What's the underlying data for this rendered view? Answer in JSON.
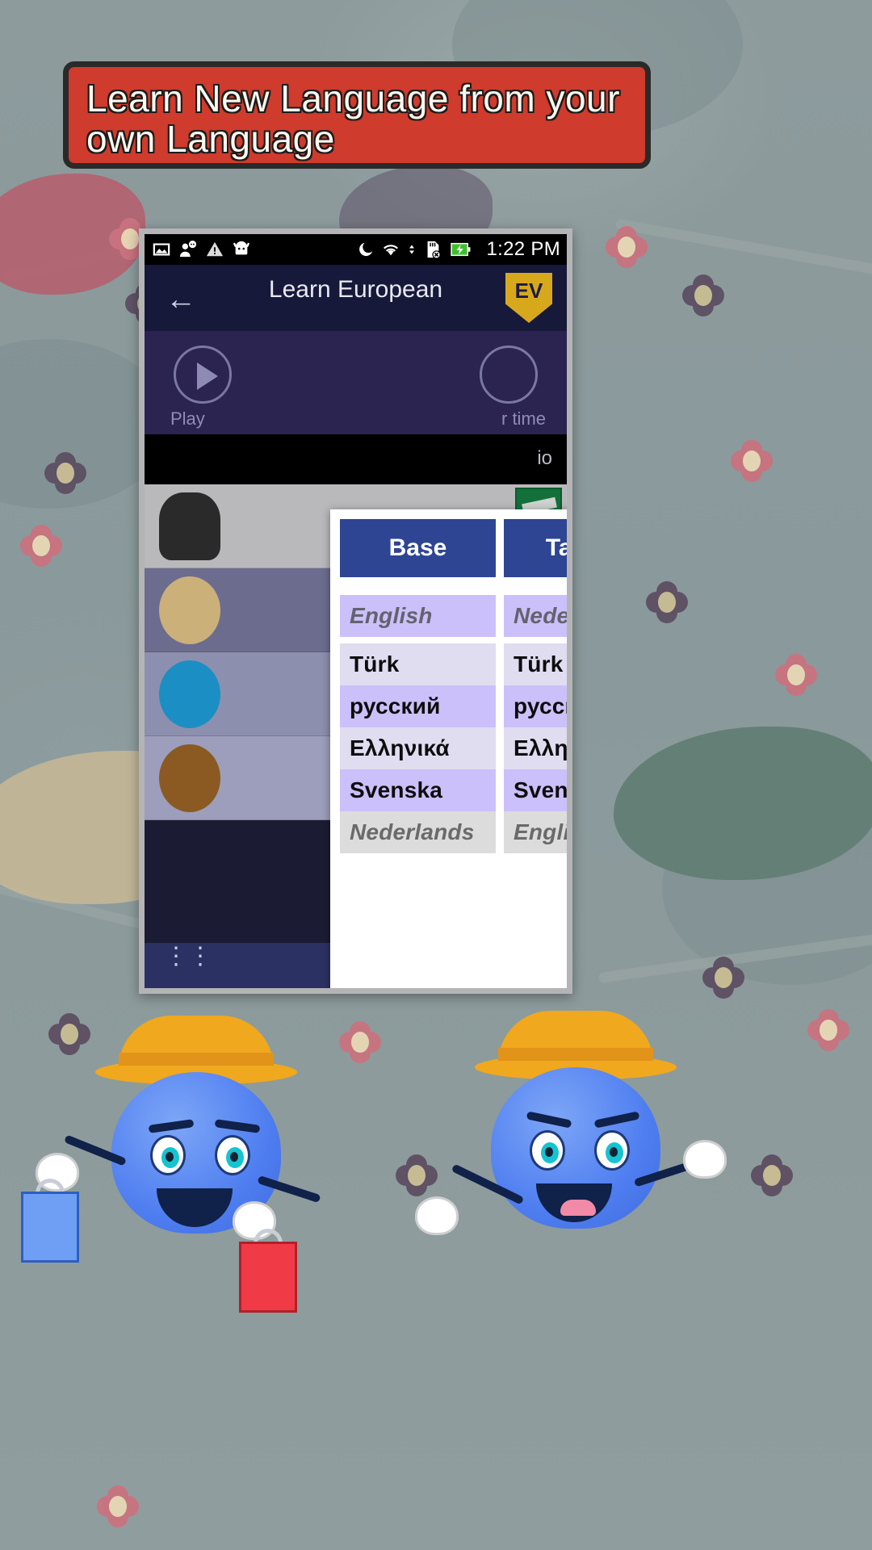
{
  "banner": {
    "line1": "Learn New Language from your",
    "line2": "own Language"
  },
  "statusbar": {
    "time": "1:22 PM",
    "icons": [
      "image-icon",
      "person-speech-icon",
      "warning-triangle-icon",
      "android-robot-icon",
      "do-not-disturb-moon-icon",
      "wifi-icon",
      "sd-card-removed-icon",
      "battery-charging-icon"
    ]
  },
  "background_app": {
    "title": "Learn European",
    "back_label": "←",
    "badge_label": "EV",
    "play_label_left": "Play",
    "play_label_right": "r time",
    "band_label": "io"
  },
  "dialog": {
    "tabs": [
      {
        "label": "Base",
        "name": "base"
      },
      {
        "label": "Target",
        "name": "target"
      }
    ],
    "base_column": {
      "current": "English",
      "options": [
        "Türk",
        "русский",
        "Ελληνικά",
        "Svenska"
      ],
      "disabled": "Nederlands"
    },
    "target_column": {
      "current": "Nederlands",
      "options": [
        "Türk",
        "русский",
        "Ελληνικά",
        "Svenska"
      ],
      "disabled": "English"
    }
  },
  "colors": {
    "banner_red": "#cf3b2c",
    "tab_blue": "#2e4594",
    "row_light": "#e0ddf1",
    "row_lavender": "#ccc0fa",
    "row_disabled": "#dcdcdc",
    "wallpaper": "#8b9a9c",
    "battery_green": "#3fbf2e"
  }
}
